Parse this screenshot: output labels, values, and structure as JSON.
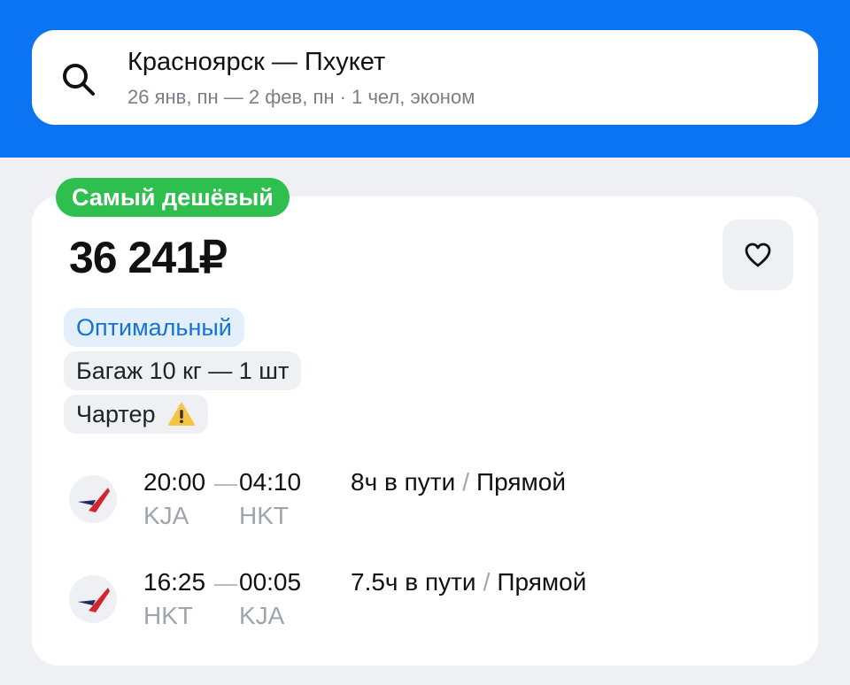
{
  "search": {
    "route": "Красноярск — Пхукет",
    "dates": "26 янв, пн — 2 фев, пн",
    "separator": "·",
    "passengers": "1 чел, эконом"
  },
  "offer": {
    "badge": "Самый дешёвый",
    "price": "36 241₽",
    "tags": {
      "optimal": "Оптимальный",
      "baggage": "Багаж 10 кг — 1 шт",
      "charter": "Чартер"
    },
    "legs": [
      {
        "dep_time": "20:00",
        "arr_time": "04:10",
        "dep_code": "KJA",
        "arr_code": "HKT",
        "duration": "8ч в пути",
        "slash": "/",
        "stops": "Прямой"
      },
      {
        "dep_time": "16:25",
        "arr_time": "00:05",
        "dep_code": "HKT",
        "arr_code": "KJA",
        "duration": "7.5ч в пути",
        "slash": "/",
        "stops": "Прямой"
      }
    ]
  },
  "colors": {
    "brand": "#0b74f3",
    "badge": "#2fbf4f",
    "optimal_text": "#1572d6",
    "warning": "#f5c542"
  },
  "icons": [
    "search-icon",
    "heart-icon",
    "warning-icon",
    "airline-logo"
  ]
}
